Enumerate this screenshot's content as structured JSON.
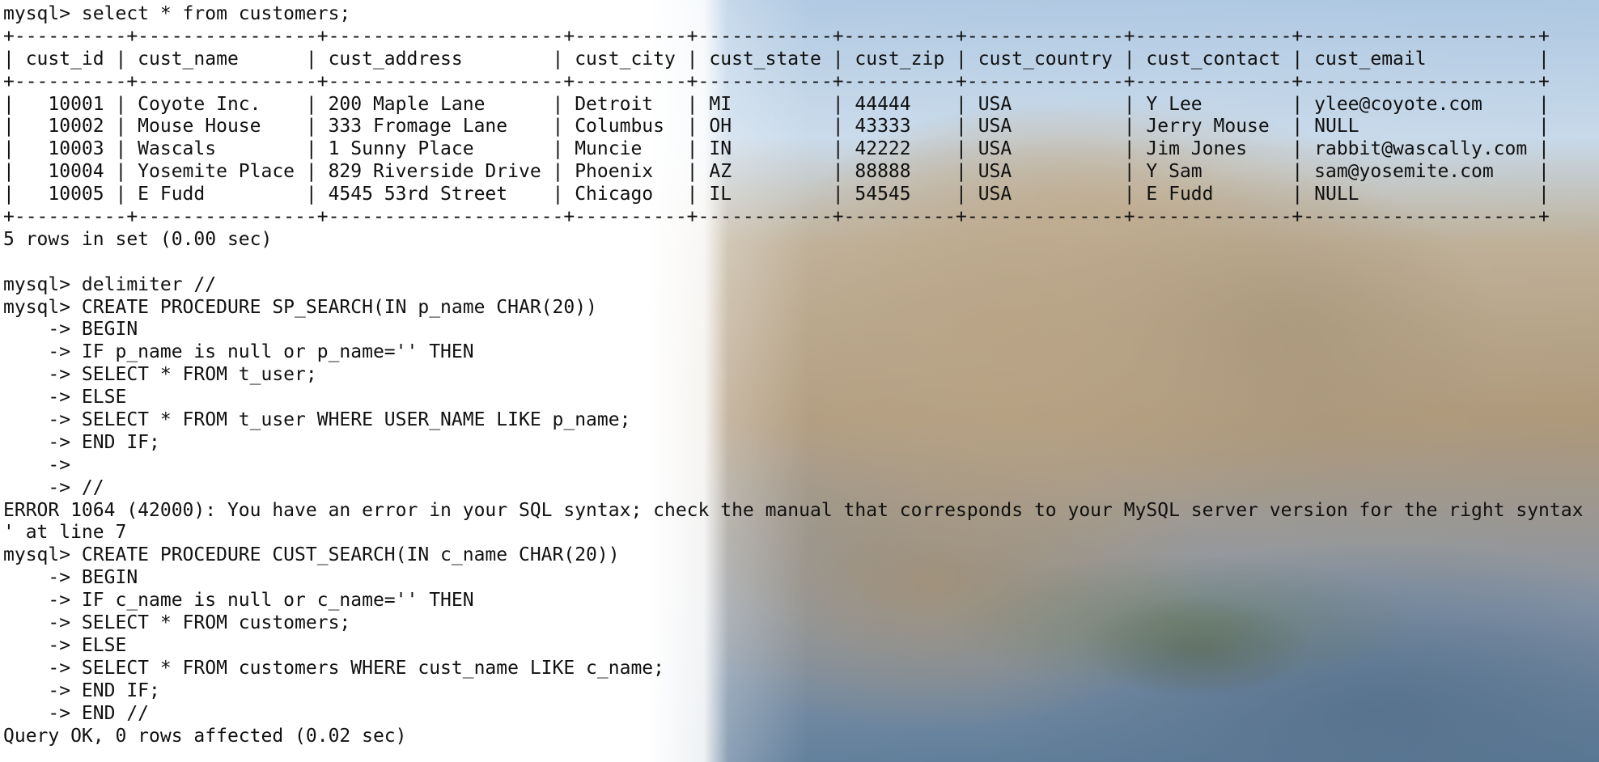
{
  "terminal": {
    "lines": [
      "mysql> select * from customers;",
      "+----------+----------------+---------------------+----------+------------+----------+--------------+--------------+---------------------+",
      "| cust_id | cust_name      | cust_address        | cust_city | cust_state | cust_zip | cust_country | cust_contact | cust_email          |",
      "+----------+----------------+---------------------+----------+------------+----------+--------------+--------------+---------------------+",
      "|   10001 | Coyote Inc.    | 200 Maple Lane      | Detroit   | MI         | 44444    | USA          | Y Lee        | ylee@coyote.com     |",
      "|   10002 | Mouse House    | 333 Fromage Lane    | Columbus  | OH         | 43333    | USA          | Jerry Mouse  | NULL                |",
      "|   10003 | Wascals        | 1 Sunny Place       | Muncie    | IN         | 42222    | USA          | Jim Jones    | rabbit@wascally.com |",
      "|   10004 | Yosemite Place | 829 Riverside Drive | Phoenix   | AZ         | 88888    | USA          | Y Sam        | sam@yosemite.com    |",
      "|   10005 | E Fudd         | 4545 53rd Street    | Chicago   | IL         | 54545    | USA          | E Fudd       | NULL                |",
      "+----------+----------------+---------------------+----------+------------+----------+--------------+--------------+---------------------+",
      "5 rows in set (0.00 sec)",
      "",
      "mysql> delimiter //",
      "mysql> CREATE PROCEDURE SP_SEARCH(IN p_name CHAR(20))",
      "    -> BEGIN",
      "    -> IF p_name is null or p_name='' THEN",
      "    -> SELECT * FROM t_user;",
      "    -> ELSE",
      "    -> SELECT * FROM t_user WHERE USER_NAME LIKE p_name;",
      "    -> END IF;",
      "    ->",
      "    -> //",
      "ERROR 1064 (42000): You have an error in your SQL syntax; check the manual that corresponds to your MySQL server version for the right syntax",
      "' at line 7",
      "mysql> CREATE PROCEDURE CUST_SEARCH(IN c_name CHAR(20))",
      "    -> BEGIN",
      "    -> IF c_name is null or c_name='' THEN",
      "    -> SELECT * FROM customers;",
      "    -> ELSE",
      "    -> SELECT * FROM customers WHERE cust_name LIKE c_name;",
      "    -> END IF;",
      "    -> END //",
      "Query OK, 0 rows affected (0.02 sec)"
    ]
  }
}
